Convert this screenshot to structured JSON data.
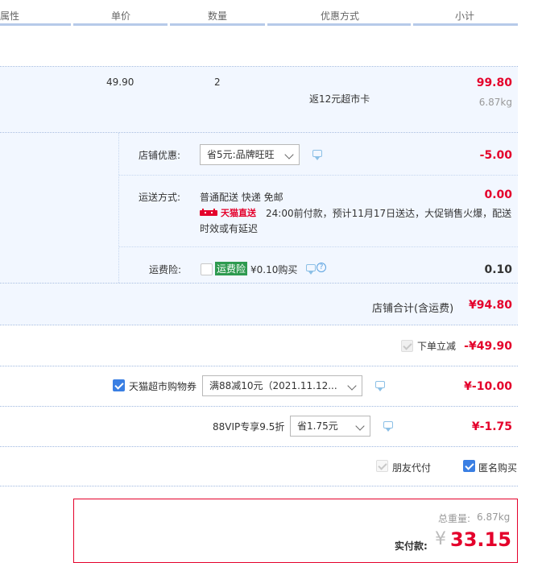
{
  "header": {
    "col_attr": "属性",
    "col_price": "单价",
    "col_qty": "数量",
    "col_discount": "优惠方式",
    "col_subtotal": "小计"
  },
  "item": {
    "unit_price": "49.90",
    "quantity": "2",
    "promotion": "返12元超市卡",
    "subtotal": "99.80",
    "weight": "6.87kg"
  },
  "shop": {
    "discount_label": "店铺优惠:",
    "discount_option": "省5元:品牌旺旺",
    "discount_amount": "-5.00",
    "shipping_label": "运送方式:",
    "shipping_method": "普通配送 快递 免邮",
    "shipping_amount": "0.00",
    "tmall_direct": "天猫直送",
    "shipping_note_1": "24:00前付款，预计11月17日送达，大促销售火爆，配送",
    "shipping_note_2": "时效或有延迟",
    "insurance_label": "运费险:",
    "insurance_tag": "运费险",
    "insurance_price": "¥0.10购买",
    "insurance_amount": "0.10",
    "total_label": "店铺合计(含运费)",
    "total_amount": "¥94.80"
  },
  "order_discount": {
    "label": "下单立减",
    "amount": "-¥49.90"
  },
  "coupon": {
    "label": "天猫超市购物券",
    "option": "满88减10元（2021.11.12...",
    "amount": "¥-10.00"
  },
  "vip": {
    "label": "88VIP专享9.5折",
    "option": "省1.75元",
    "amount": "¥-1.75"
  },
  "options": {
    "friend_pay": "朋友代付",
    "anonymous": "匿名购买"
  },
  "summary": {
    "weight_label": "总重量:",
    "weight_value": "6.87kg",
    "pay_label": "实付款:",
    "currency": "¥",
    "pay_amount": "33.15"
  },
  "colors": {
    "accent_red": "#e4002b",
    "header_line": "#b6cae9",
    "blue_bg": "#f2f7ff",
    "check_blue": "#3a7fe3"
  }
}
